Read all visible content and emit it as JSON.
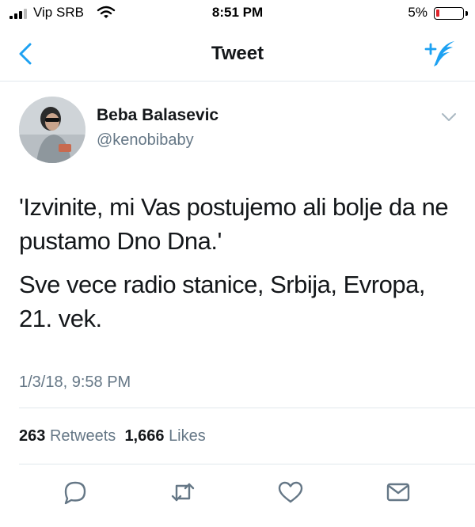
{
  "status_bar": {
    "carrier": "Vip SRB",
    "time": "8:51 PM",
    "battery": "5%",
    "battery_level": 0.05
  },
  "nav": {
    "title": "Tweet",
    "back_icon": "chevron-left-icon",
    "compose_icon": "compose-tweet-icon"
  },
  "tweet": {
    "author_name": "Beba Balasevic",
    "author_handle": "@kenobibaby",
    "paragraphs": [
      "'Izvinite, mi Vas postujemo ali bolje da ne pustamo Dno Dna.'",
      "Sve vece radio stanice, Srbija, Evropa, 21. vek."
    ],
    "timestamp": "1/3/18, 9:58 PM"
  },
  "stats": {
    "retweets_count": "263",
    "retweets_label": "Retweets",
    "likes_count": "1,666",
    "likes_label": "Likes"
  },
  "actions": [
    "reply-icon",
    "retweet-icon",
    "like-icon",
    "share-dm-icon"
  ],
  "colors": {
    "accent": "#1da1f2",
    "text": "#14171a",
    "muted": "#657786",
    "divider": "#e1e8ed",
    "battery_low": "#e0242c"
  }
}
